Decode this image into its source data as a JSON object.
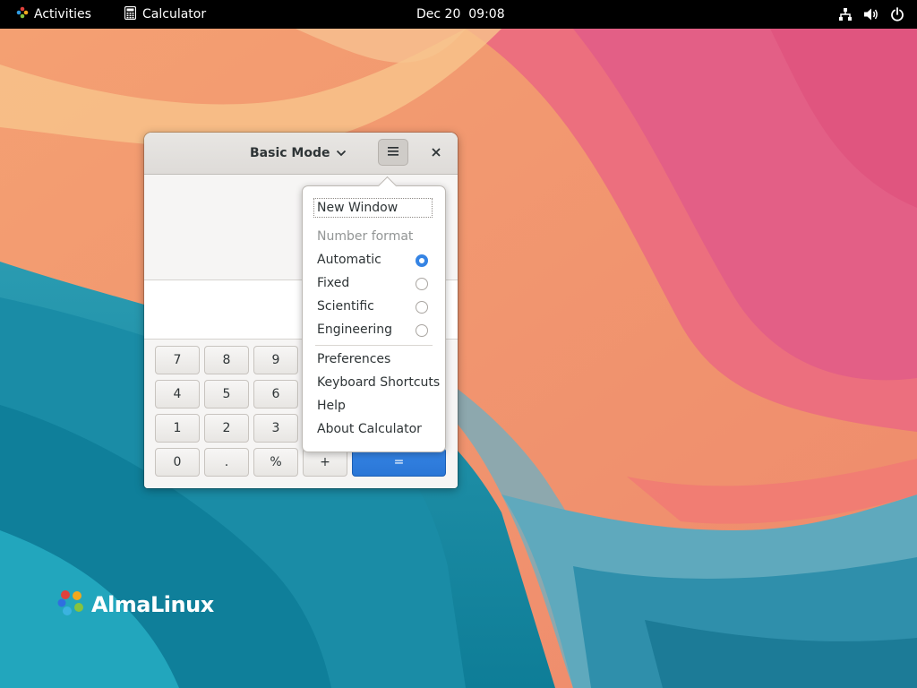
{
  "topbar": {
    "activities_label": "Activities",
    "app_name": "Calculator",
    "clock": "Dec 20  09:08",
    "status_icons": [
      "network-icon",
      "volume-icon",
      "power-icon"
    ]
  },
  "desktop": {
    "brand_text": "AlmaLinux"
  },
  "calculator": {
    "mode_label": "Basic Mode",
    "keys": [
      {
        "label": "7"
      },
      {
        "label": "8"
      },
      {
        "label": "9"
      },
      {
        "label": "4"
      },
      {
        "label": "5"
      },
      {
        "label": "6"
      },
      {
        "label": "1"
      },
      {
        "label": "2"
      },
      {
        "label": "3"
      },
      {
        "label": "0"
      },
      {
        "label": "."
      },
      {
        "label": "%"
      },
      {
        "label": "+"
      },
      {
        "label": "="
      }
    ]
  },
  "menu": {
    "new_window": "New Window",
    "number_format_heading": "Number format",
    "formats": [
      {
        "label": "Automatic",
        "selected": true
      },
      {
        "label": "Fixed",
        "selected": false
      },
      {
        "label": "Scientific",
        "selected": false
      },
      {
        "label": "Engineering",
        "selected": false
      }
    ],
    "preferences": "Preferences",
    "keyboard_shortcuts": "Keyboard Shortcuts",
    "help": "Help",
    "about": "About Calculator"
  },
  "colors": {
    "accent": "#3584e4",
    "topbar": "#000000"
  }
}
